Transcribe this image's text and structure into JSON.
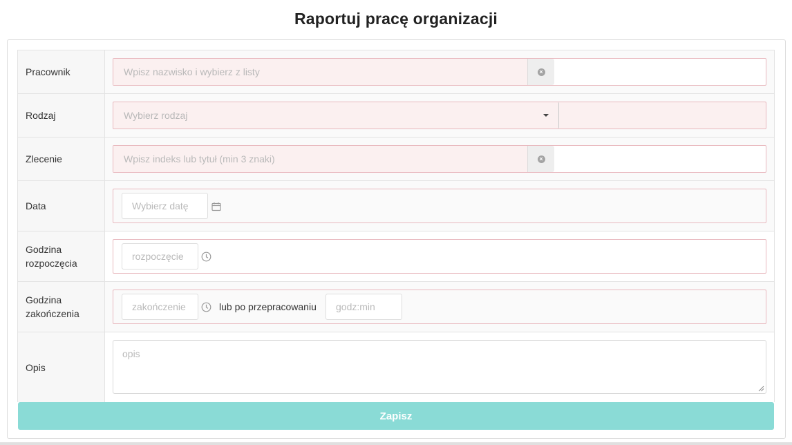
{
  "page": {
    "title": "Raportuj pracę organizacji"
  },
  "form": {
    "pracownik": {
      "label": "Pracownik",
      "placeholder": "Wpisz nazwisko i wybierz z listy"
    },
    "rodzaj": {
      "label": "Rodzaj",
      "placeholder": "Wybierz rodzaj"
    },
    "zlecenie": {
      "label": "Zlecenie",
      "placeholder": "Wpisz indeks lub tytuł (min 3 znaki)"
    },
    "data": {
      "label": "Data",
      "placeholder": "Wybierz datę"
    },
    "godzina_rozpoczecia": {
      "label": "Godzina rozpoczęcia",
      "placeholder": "rozpoczęcie"
    },
    "godzina_zakonczenia": {
      "label": "Godzina zakończenia",
      "placeholder": "zakończenie",
      "or_text": "lub po przepracowaniu",
      "duration_placeholder": "godz:min"
    },
    "opis": {
      "label": "Opis",
      "placeholder": "opis"
    },
    "submit_label": "Zapisz"
  },
  "colors": {
    "error_border": "#e8b7bd",
    "error_fill": "#fbf0f0",
    "submit_button": "#8adbd6"
  },
  "icons": {
    "clear": "times-circle-icon",
    "dropdown": "caret-down-icon",
    "date": "calendar-icon",
    "time": "clock-icon"
  }
}
